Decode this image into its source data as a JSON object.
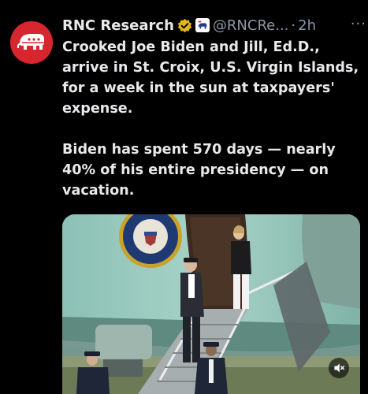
{
  "tweet": {
    "author_name": "RNC Research",
    "handle": "@RNCRe...",
    "separator": "·",
    "time": "2h",
    "more_label": "···",
    "text_paragraph_1": "Crooked Joe Biden and Jill, Ed.D.,\narrive in St. Croix, U.S. Virgin Islands,\nfor a week in the sun at taxpayers'\nexpense.",
    "text_paragraph_2": "Biden has spent 570 days — nearly\n40% of his entire presidency — on\nvacation."
  },
  "icons": {
    "avatar": "republican-elephant-logo",
    "verified": "gold-verified-badge-icon",
    "affiliate": "affiliate-badge-icon",
    "mute": "speaker-muted-icon"
  },
  "colors": {
    "background": "#000000",
    "text": "#e7e9ea",
    "secondary_text": "#8b98a5",
    "avatar_red": "#d8262f",
    "verified_gold": "#e2b719"
  }
}
